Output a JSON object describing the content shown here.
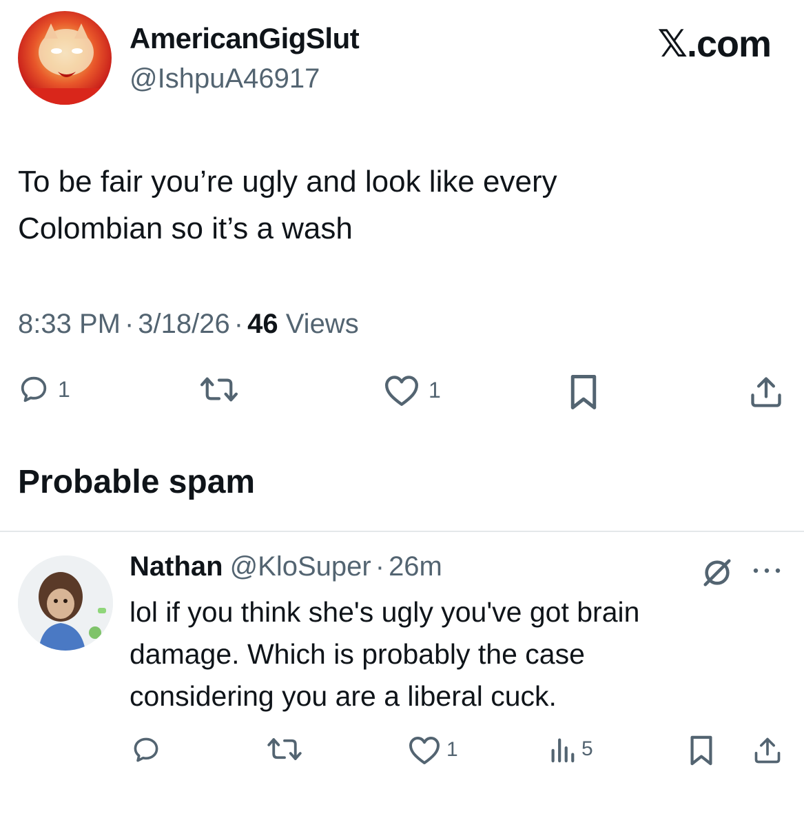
{
  "tweet": {
    "author_name": "AmericanGigSlut",
    "author_handle": "@IshpuA46917",
    "brand_mark": "𝕏",
    "brand_suffix": ".com",
    "text_line1": "To be fair you’re ugly and look like every",
    "text_line2": "Colombian so it’s a wash",
    "time": "8:33 PM",
    "date": "3/18/26",
    "separator": "·",
    "views_count": "46",
    "views_label": "Views",
    "actions": {
      "reply_count": "1",
      "like_count": "1"
    }
  },
  "section": {
    "spam_heading": "Probable spam"
  },
  "reply": {
    "author_name": "Nathan",
    "author_handle": "@KloSuper",
    "separator": "·",
    "time_ago": "26m",
    "text_line1": "lol if you think she's ugly you've got brain",
    "text_line2": "damage. Which is probably the case",
    "text_line3": "considering you are a liberal cuck.",
    "actions": {
      "like_count": "1",
      "views_count": "5"
    }
  },
  "icons": {
    "reply": "reply-icon",
    "retweet": "retweet-icon",
    "like": "heart-icon",
    "bookmark": "bookmark-icon",
    "share": "share-icon",
    "views": "analytics-icon",
    "grok": "grok-icon",
    "more": "more-icon"
  },
  "colors": {
    "text_primary": "#0f1419",
    "text_secondary": "#536471",
    "divider": "#e4e8ea"
  }
}
